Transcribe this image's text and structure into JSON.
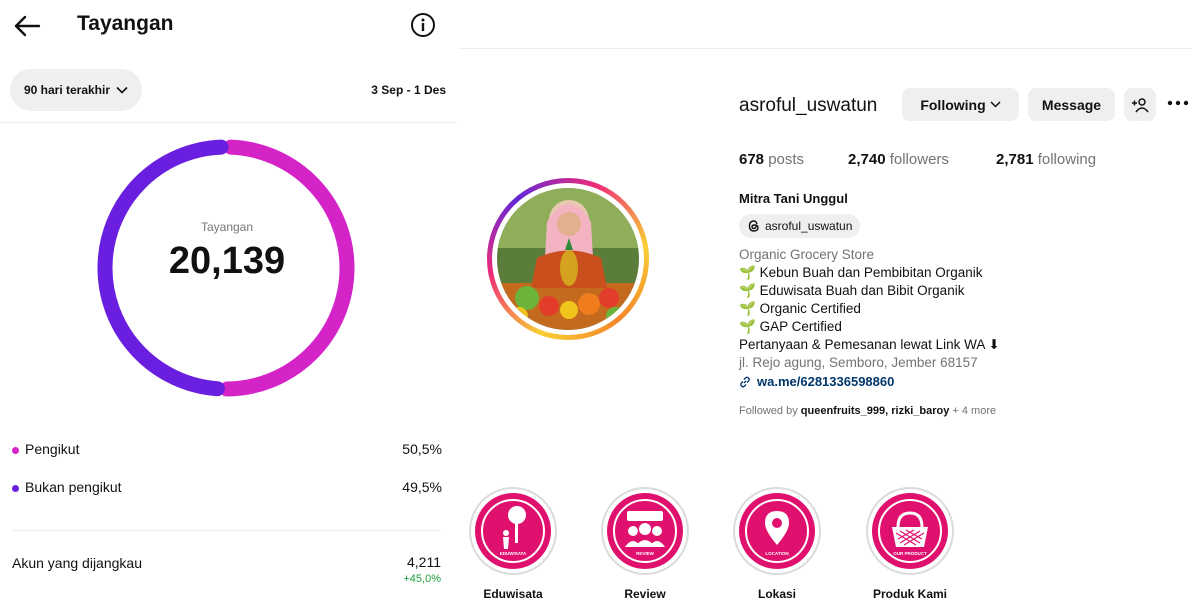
{
  "left": {
    "title": "Tayangan",
    "range_label": "90 hari terakhir",
    "date_range": "3 Sep - 1 Des",
    "donut": {
      "label": "Tayangan",
      "value": "20,139"
    },
    "legend": [
      {
        "label": "Pengikut",
        "value": "50,5%",
        "color": "#d424c8",
        "fraction": 0.505
      },
      {
        "label": "Bukan pengikut",
        "value": "49,5%",
        "color": "#6a1fe0",
        "fraction": 0.495
      }
    ],
    "reach": {
      "label": "Akun yang dijangkau",
      "value": "4,211",
      "delta": "+45,0%"
    }
  },
  "profile": {
    "username": "asroful_uswatun",
    "following_btn": "Following",
    "message_btn": "Message",
    "posts_count": "678",
    "posts_label": "posts",
    "followers_count": "2,740",
    "followers_label": "followers",
    "following_count": "2,781",
    "following_label": "following",
    "display_name": "Mitra Tani Unggul",
    "threads_handle": "asroful_uswatun",
    "category": "Organic Grocery Store",
    "bio_lines": [
      "Kebun Buah dan Pembibitan Organik",
      "Eduwisata Buah dan Bibit Organik",
      "Organic Certified",
      "GAP Certified"
    ],
    "cta": "Pertanyaan & Pemesanan lewat Link WA ⬇",
    "address": "jl. Rejo agung, Semboro, Jember 68157",
    "link": "wa.me/6281336598860",
    "followed_by_prefix": "Followed by",
    "followed_by_users": "queenfruits_999, rizki_baroy",
    "followed_by_more": "+ 4 more"
  },
  "highlights": [
    {
      "label": "Eduwisata",
      "caption": "EDUWISATA"
    },
    {
      "label": "Review",
      "caption": "REVIEW"
    },
    {
      "label": "Lokasi",
      "caption": "LOCATION"
    },
    {
      "label": "Produk Kami",
      "caption": "OUR PRODUCT"
    }
  ],
  "colors": {
    "accent_pink": "#e0106e",
    "link_blue": "#00376b",
    "positive": "#1e9e3e"
  }
}
